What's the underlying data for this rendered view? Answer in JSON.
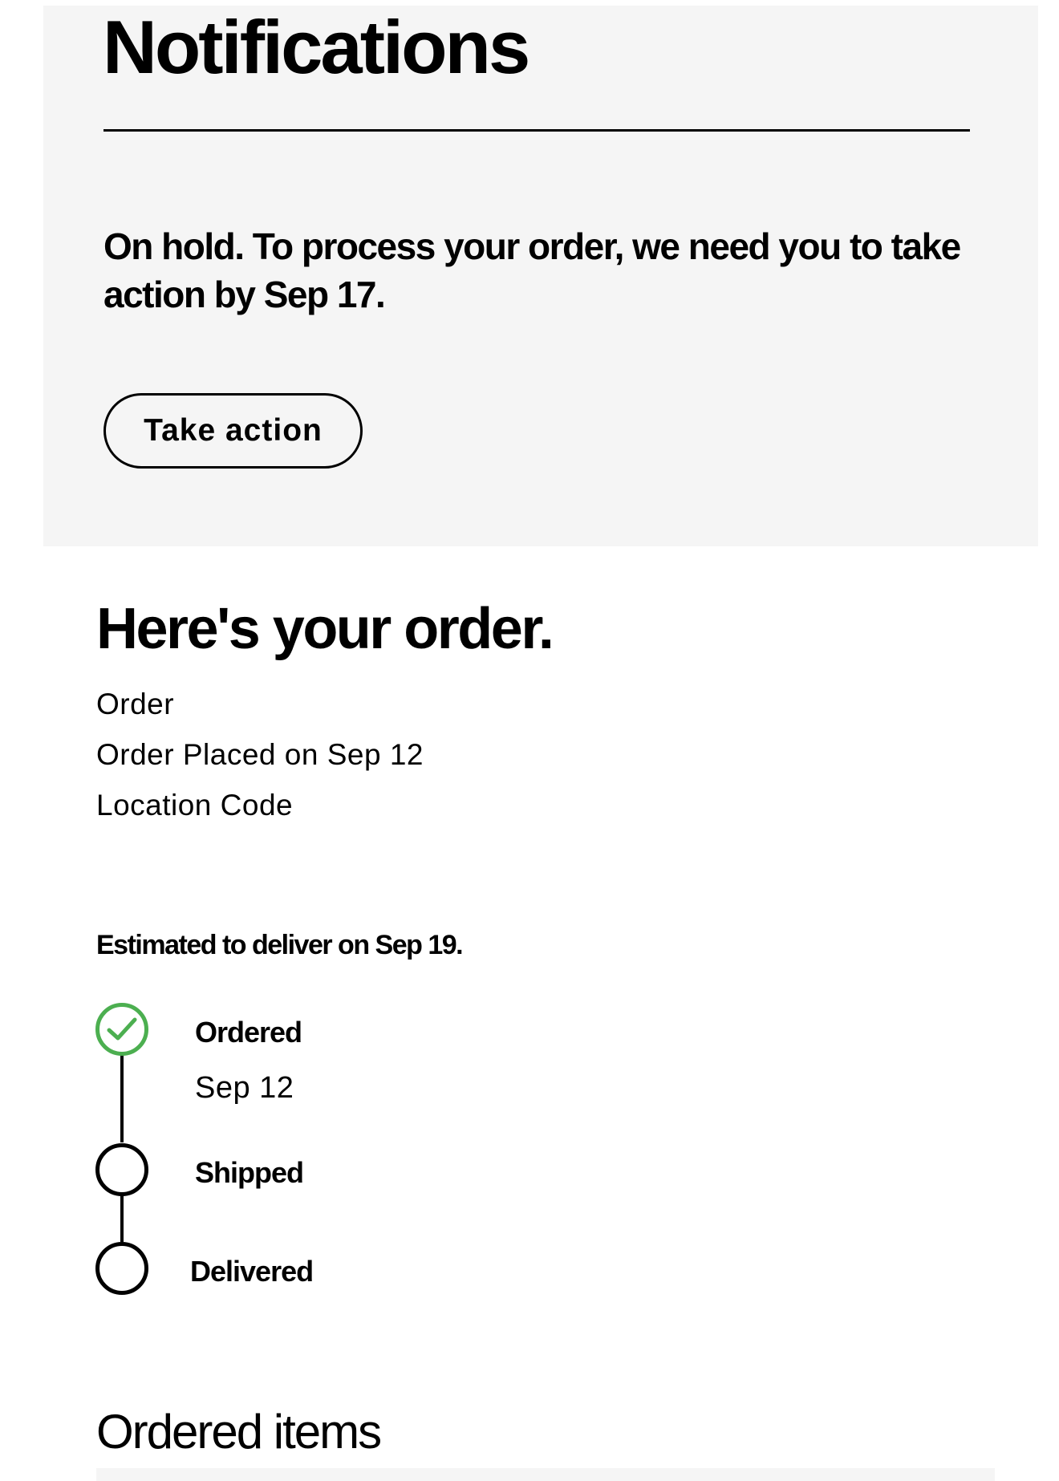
{
  "notifications": {
    "title": "Notifications",
    "message": "On hold. To process your order, we need you to take action by Sep 17.",
    "action_label": "Take action"
  },
  "order": {
    "heading": "Here's your order.",
    "order_label": "Order",
    "placed_text": "Order Placed on Sep 12",
    "location_label": "Location Code"
  },
  "delivery": {
    "estimate": "Estimated to deliver on Sep 19."
  },
  "tracking": {
    "steps": [
      {
        "label": "Ordered",
        "date": "Sep 12",
        "status": "complete",
        "status_color": "#4caf50"
      },
      {
        "label": "Shipped",
        "status": "pending"
      },
      {
        "label": "Delivered",
        "status": "pending"
      }
    ]
  },
  "ordered_items": {
    "heading": "Ordered items"
  }
}
